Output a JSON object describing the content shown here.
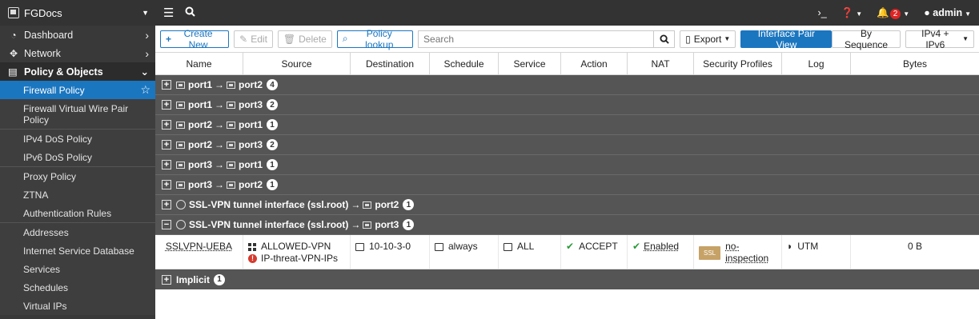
{
  "app": {
    "name": "FGDocs"
  },
  "sidebar": {
    "top_items": [
      {
        "label": "Dashboard"
      },
      {
        "label": "Network"
      }
    ],
    "section": {
      "label": "Policy & Objects"
    },
    "sub_items": [
      {
        "label": "Firewall Policy"
      },
      {
        "label": "Firewall Virtual Wire Pair Policy"
      },
      {
        "label": "IPv4 DoS Policy"
      },
      {
        "label": "IPv6 DoS Policy"
      },
      {
        "label": "Proxy Policy"
      },
      {
        "label": "ZTNA"
      },
      {
        "label": "Authentication Rules"
      },
      {
        "label": "Addresses"
      },
      {
        "label": "Internet Service Database"
      },
      {
        "label": "Services"
      },
      {
        "label": "Schedules"
      },
      {
        "label": "Virtual IPs"
      }
    ]
  },
  "topbar": {
    "cli_glyph": "›_",
    "notif_count": "2",
    "user": "admin"
  },
  "toolbar": {
    "create_new": "Create New",
    "edit": "Edit",
    "delete": "Delete",
    "policy_lookup": "Policy lookup",
    "search_placeholder": "Search",
    "export": "Export",
    "interface_pair_view": "Interface Pair View",
    "by_sequence": "By Sequence",
    "ip_version": "IPv4 + IPv6"
  },
  "table": {
    "columns": [
      "Name",
      "Source",
      "Destination",
      "Schedule",
      "Service",
      "Action",
      "NAT",
      "Security Profiles",
      "Log",
      "Bytes"
    ],
    "groups": [
      {
        "src": "port1",
        "dst": "port2",
        "count": "4"
      },
      {
        "src": "port1",
        "dst": "port3",
        "count": "2"
      },
      {
        "src": "port2",
        "dst": "port1",
        "count": "1"
      },
      {
        "src": "port2",
        "dst": "port3",
        "count": "2"
      },
      {
        "src": "port3",
        "dst": "port1",
        "count": "1"
      },
      {
        "src": "port3",
        "dst": "port2",
        "count": "1"
      },
      {
        "src": "SSL-VPN tunnel interface (ssl.root)",
        "dst": "port2",
        "count": "1"
      },
      {
        "src": "SSL-VPN tunnel interface (ssl.root)",
        "dst": "port3",
        "count": "1"
      }
    ],
    "policy": {
      "name": "SSLVPN-UEBA",
      "source_1": "ALLOWED-VPN",
      "source_2": "IP-threat-VPN-IPs",
      "destination": "10-10-3-0",
      "schedule": "always",
      "service": "ALL",
      "action": "ACCEPT",
      "nat": "Enabled",
      "ssl_tag": "SSL",
      "security_profile": "no-inspection",
      "log": "UTM",
      "bytes": "0 B"
    },
    "implicit": {
      "label": "Implicit",
      "count": "1"
    }
  }
}
